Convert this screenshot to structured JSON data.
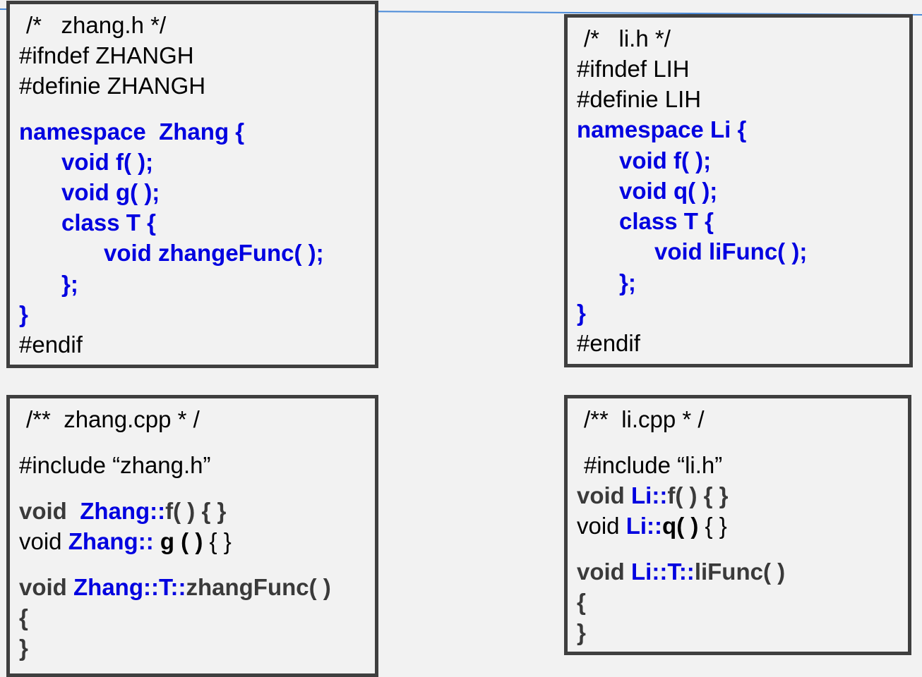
{
  "zhang_h": {
    "lines": [
      "/*   zhang.h */",
      "#ifndef ZHANGH",
      "#definie ZHANGH",
      "namespace  Zhang {",
      "void f( );",
      "void g( );",
      "class T {",
      "void zhangeFunc( );",
      "};",
      "}",
      "#endif"
    ]
  },
  "li_h": {
    "lines": [
      "/*   li.h */",
      "#ifndef LIH",
      "#definie LIH",
      "namespace Li {",
      "void f( );",
      "void q( );",
      "class T {",
      "void liFunc( );",
      "};",
      "}",
      "#endif"
    ]
  },
  "zhang_cpp": {
    "comment": "/**  zhang.cpp * /",
    "include": "#include “zhang.h”",
    "l1": [
      "void  ",
      "Zhang::",
      "f( ) { }"
    ],
    "l2": [
      "void ",
      "Zhang:: ",
      "g ( ) ",
      "{ }"
    ],
    "l3": [
      "void ",
      "Zhang::T::",
      "zhangFunc( )"
    ],
    "open": "{",
    "close": "}"
  },
  "li_cpp": {
    "comment": "/**  li.cpp * /",
    "include": "#include “li.h”",
    "l1": [
      "void ",
      "Li::",
      "f( ) { }"
    ],
    "l2": [
      "void ",
      "Li::",
      "q( ) ",
      "{ }"
    ],
    "l3": [
      "void ",
      "Li::T::",
      "liFunc( )"
    ],
    "open": "{",
    "close": "}"
  }
}
